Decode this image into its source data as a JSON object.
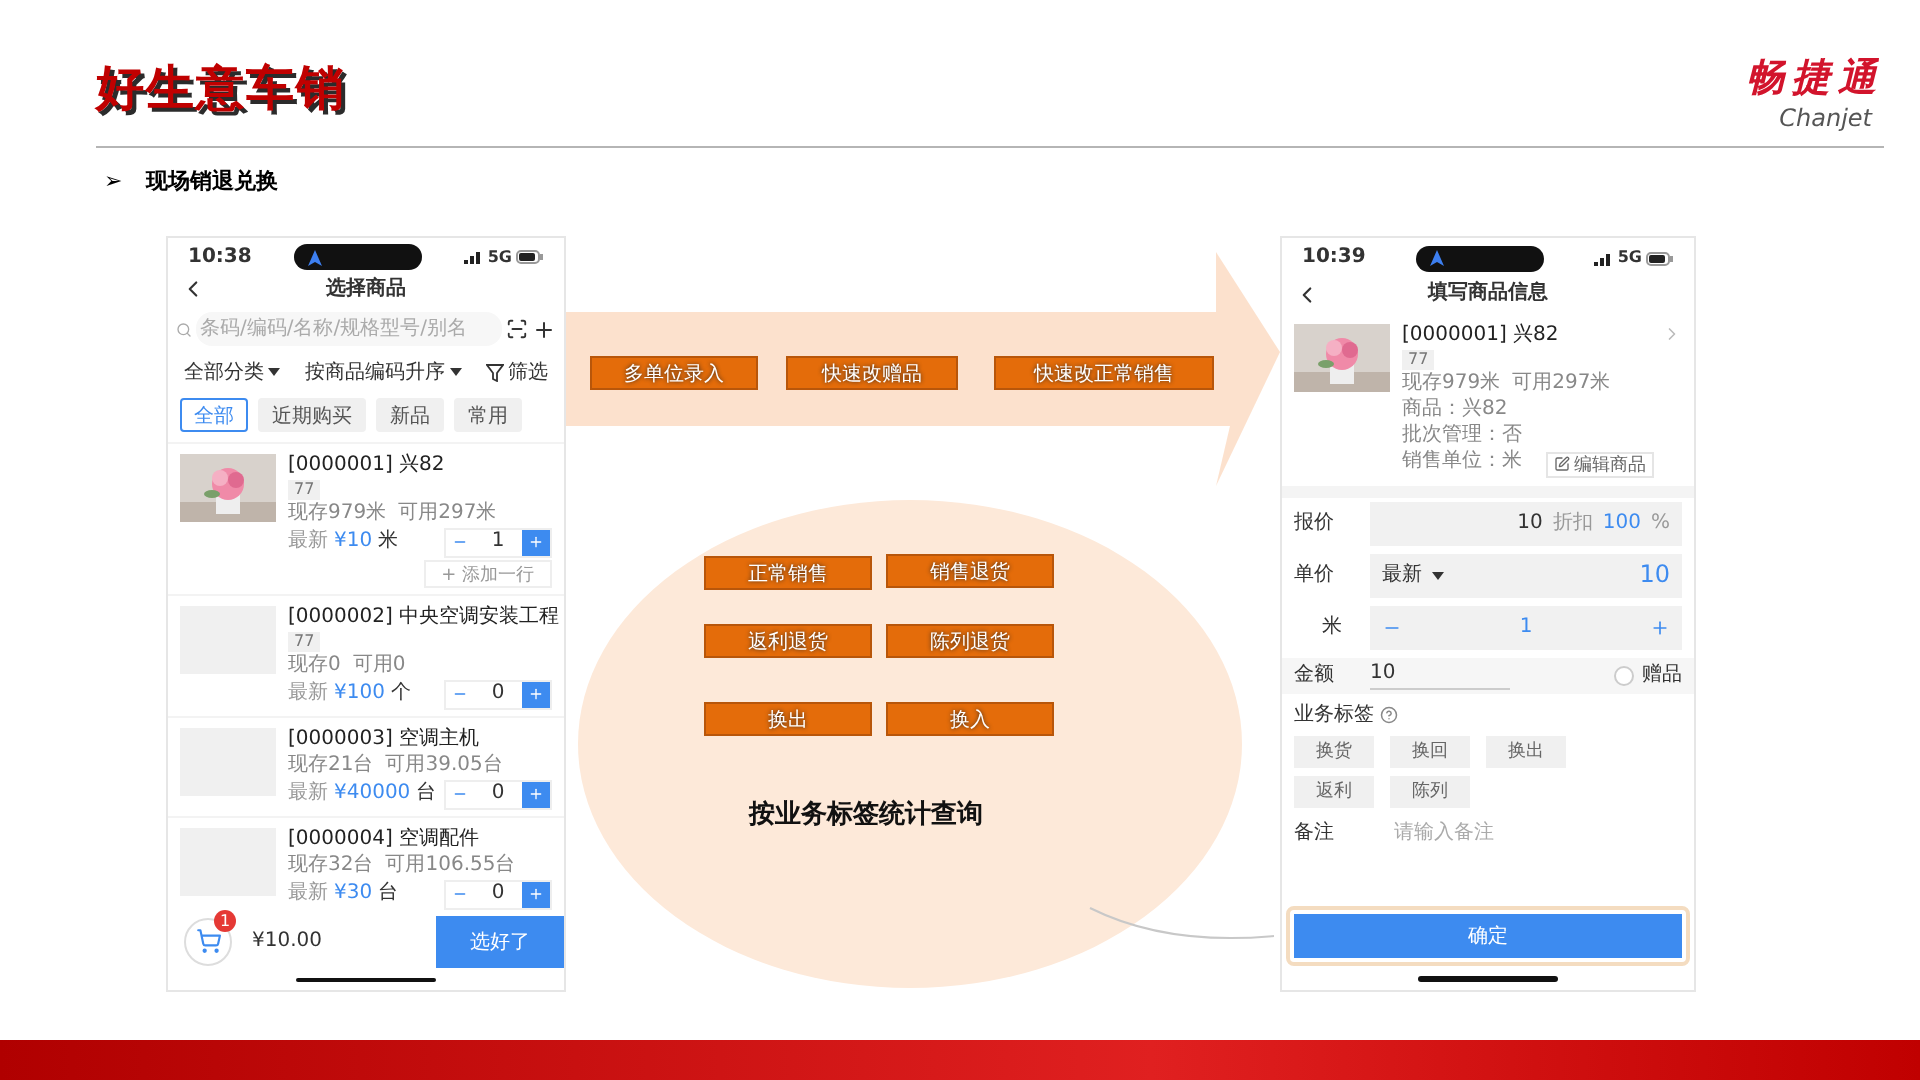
{
  "header": {
    "title": "好生意车销",
    "bullet": "➢",
    "subtitle": "现场销退兑换"
  },
  "logo": {
    "cn": "畅捷通",
    "en": "Chanjet"
  },
  "left_phone": {
    "status": {
      "time": "10:38",
      "network": "5G"
    },
    "title": "选择商品",
    "search": {
      "placeholder": "条码/编码/名称/规格型号/别名"
    },
    "filters": [
      {
        "label": "全部分类",
        "kind": "dropdown"
      },
      {
        "label": "按商品编码升序",
        "kind": "dropdown"
      },
      {
        "label": "筛选",
        "kind": "filter"
      }
    ],
    "chips": [
      {
        "label": "全部",
        "selected": true
      },
      {
        "label": "近期购买",
        "selected": false
      },
      {
        "label": "新品",
        "selected": false
      },
      {
        "label": "常用",
        "selected": false
      }
    ],
    "products": [
      {
        "name": "[0000001] 兴82",
        "tag": "77",
        "stock": "现存979米",
        "available": "可用297米",
        "price_label": "最新",
        "price": "¥10",
        "unit": "米",
        "qty": "1",
        "add_row": "+ 添加一行"
      },
      {
        "name": "[0000002] 中央空调安装工程",
        "kind": "placeholder",
        "tag": "77",
        "stock": "现存0",
        "available": "可用0",
        "price_label": "最新",
        "price": "¥100",
        "unit": "个",
        "qty": "0"
      },
      {
        "name": "[0000003] 空调主机",
        "kind": "placeholder",
        "stock": "现存21台",
        "available": "可用39.05台",
        "price_label": "最新",
        "price": "¥40000",
        "unit": "台",
        "qty": "0"
      },
      {
        "name": "[0000004] 空调配件",
        "kind": "placeholder",
        "stock": "现存32台",
        "available": "可用106.55台",
        "price_label": "最新",
        "price": "¥30",
        "unit": "台",
        "qty": "0"
      }
    ],
    "cart": {
      "badge": "1",
      "total": "¥10.00",
      "button": "选好了"
    }
  },
  "callout": {
    "top_tags": [
      "多单位录入",
      "快速改赠品",
      "快速改正常销售"
    ],
    "grid_tags": [
      "正常销售",
      "销售退货",
      "返利退货",
      "陈列退货",
      "换出",
      "换入"
    ],
    "caption": "按业务标签统计查询"
  },
  "right_phone": {
    "status": {
      "time": "10:39",
      "network": "5G"
    },
    "title": "填写商品信息",
    "product": {
      "name": "[0000001] 兴82",
      "tag": "77",
      "stock": "现存979米",
      "available": "可用297米",
      "details": [
        "商品：兴82",
        "批次管理：否",
        "销售单位：米"
      ],
      "edit": "编辑商品"
    },
    "quote": {
      "label": "报价",
      "value": "10",
      "discount_label": "折扣",
      "discount": "100",
      "percent": "%"
    },
    "unit_price": {
      "label": "单价",
      "mode": "最新",
      "value": "10"
    },
    "quantity": {
      "label": "米",
      "value": "1"
    },
    "amount": {
      "label": "金额",
      "value": "10",
      "gift": {
        "label": "赠品",
        "checked": false
      }
    },
    "business_tags": {
      "label": "业务标签",
      "tags": [
        {
          "label": "换货",
          "selected": false
        },
        {
          "label": "换回",
          "selected": false
        },
        {
          "label": "换出",
          "selected": false
        },
        {
          "label": "返利",
          "selected": false
        },
        {
          "label": "陈列",
          "selected": false
        }
      ]
    },
    "remark": {
      "label": "备注",
      "placeholder": "请输入备注"
    },
    "confirm": "确定"
  }
}
